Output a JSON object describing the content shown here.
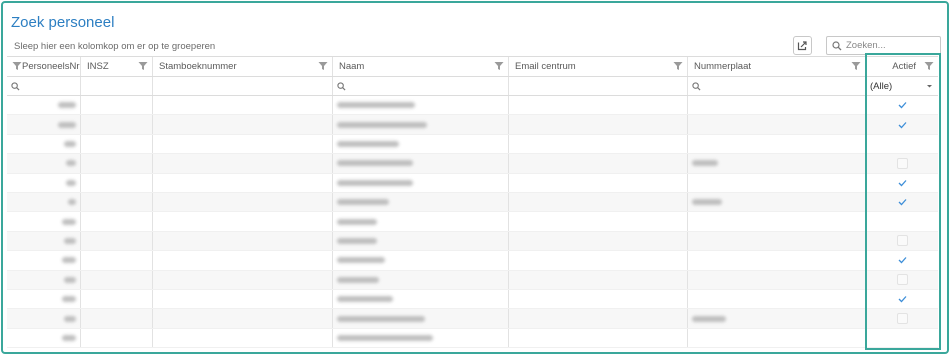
{
  "page": {
    "title": "Zoek personeel",
    "group_hint": "Sleep hier een kolomkop om er op te groeperen",
    "search_placeholder": "Zoeken..."
  },
  "columns": [
    {
      "key": "personeelsnr",
      "label": "PersoneelsNr"
    },
    {
      "key": "insz",
      "label": "INSZ"
    },
    {
      "key": "stamboeknummer",
      "label": "Stamboeknummer"
    },
    {
      "key": "naam",
      "label": "Naam"
    },
    {
      "key": "email",
      "label": "Email centrum"
    },
    {
      "key": "nummerplaat",
      "label": "Nummerplaat"
    },
    {
      "key": "actief",
      "label": "Actief"
    }
  ],
  "filter_row": {
    "actief_value": "(Alle)"
  },
  "rows": [
    {
      "nr_w": 18,
      "naam_w": 78,
      "plaat_w": 0,
      "actief": true
    },
    {
      "nr_w": 18,
      "naam_w": 90,
      "plaat_w": 0,
      "actief": true
    },
    {
      "nr_w": 12,
      "naam_w": 62,
      "plaat_w": 0,
      "actief": null
    },
    {
      "nr_w": 10,
      "naam_w": 76,
      "plaat_w": 26,
      "actief": false
    },
    {
      "nr_w": 10,
      "naam_w": 76,
      "plaat_w": 0,
      "actief": true
    },
    {
      "nr_w": 8,
      "naam_w": 52,
      "plaat_w": 30,
      "actief": true
    },
    {
      "nr_w": 14,
      "naam_w": 40,
      "plaat_w": 0,
      "actief": null
    },
    {
      "nr_w": 12,
      "naam_w": 40,
      "plaat_w": 0,
      "actief": false
    },
    {
      "nr_w": 14,
      "naam_w": 48,
      "plaat_w": 0,
      "actief": true
    },
    {
      "nr_w": 12,
      "naam_w": 42,
      "plaat_w": 0,
      "actief": false
    },
    {
      "nr_w": 14,
      "naam_w": 56,
      "plaat_w": 0,
      "actief": true
    },
    {
      "nr_w": 12,
      "naam_w": 88,
      "plaat_w": 34,
      "actief": false
    },
    {
      "nr_w": 14,
      "naam_w": 96,
      "plaat_w": 0,
      "actief": null
    }
  ],
  "colors": {
    "accent": "#3aa79b",
    "title": "#2d7fc2",
    "check": "#3d8ed8"
  },
  "icons": {
    "filter": "filter-icon",
    "search": "search-icon",
    "export": "export-icon",
    "dropdown": "chevron-down-icon"
  }
}
